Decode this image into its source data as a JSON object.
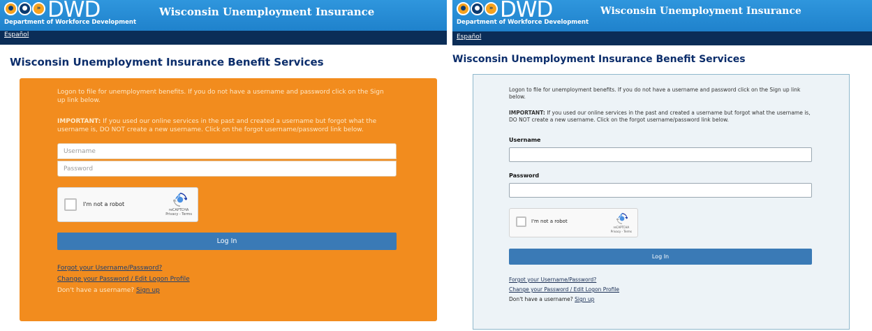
{
  "header": {
    "logo_text": "DWD",
    "department": "Department of Workforce Development",
    "app_title": "Wisconsin Unemployment Insurance",
    "language_link": "Español"
  },
  "page": {
    "title": "Wisconsin Unemployment Insurance Benefit Services"
  },
  "login": {
    "intro": "Logon to file for unemployment benefits. If you do not have a username and password click on the Sign up link below.",
    "important_label": "IMPORTANT:",
    "important_text": "If you used our online services in the past and created a username but forgot what the username is, DO NOT create a new username. Click on the forgot username/password link below.",
    "username_label": "Username",
    "password_label": "Password",
    "username_placeholder": "Username",
    "password_placeholder": "Password",
    "captcha_label": "I'm not a robot",
    "captcha_brand": "reCAPTCHA",
    "captcha_terms": "Privacy - Terms",
    "login_button": "Log In",
    "forgot_link": "Forgot your Username/Password?",
    "change_link": "Change your Password / Edit Logon Profile",
    "no_username_text": "Don't have a username?",
    "signup_link": "Sign up"
  },
  "colors": {
    "header_blue": "#1f82cc",
    "nav_navy": "#0b2d57",
    "title_navy": "#0b2d6b",
    "card_orange": "#f28c1e",
    "card_blue_bg": "#edf3f7",
    "button_blue": "#3a7ab6"
  },
  "icons": {
    "logo_circles": [
      "person-icon",
      "family-icon",
      "arrow-icon"
    ],
    "captcha_logo": "recaptcha-icon"
  }
}
